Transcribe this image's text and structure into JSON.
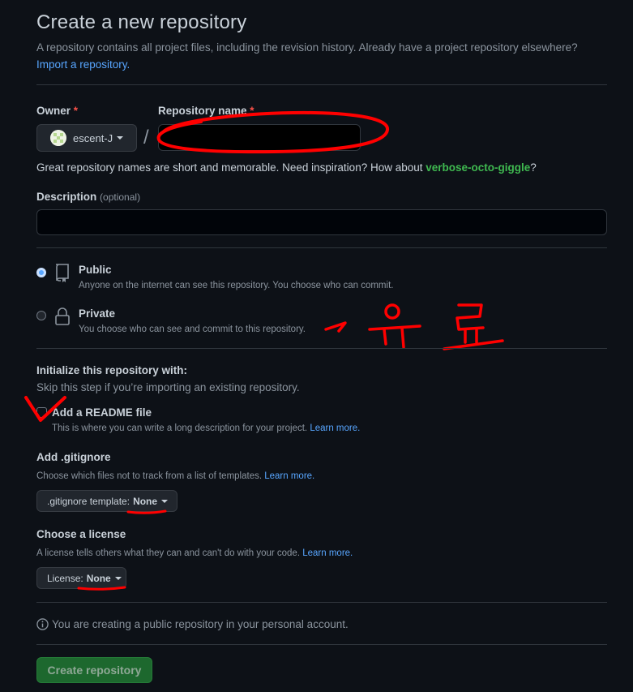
{
  "header": {
    "title": "Create a new repository",
    "description": "A repository contains all project files, including the revision history. Already have a project repository elsewhere?",
    "import_link": "Import a repository."
  },
  "owner": {
    "label": "Owner",
    "required_mark": "*",
    "value": "escent-J"
  },
  "repo_name": {
    "label": "Repository name",
    "required_mark": "*",
    "value": ""
  },
  "separator": "/",
  "suggestion": {
    "text_before": "Great repository names are short and memorable. Need inspiration? How about ",
    "suggested_name": "verbose-octo-giggle",
    "text_after": "?"
  },
  "description_field": {
    "label": "Description",
    "optional": "(optional)",
    "value": ""
  },
  "visibility": {
    "public": {
      "label": "Public",
      "description": "Anyone on the internet can see this repository. You choose who can commit.",
      "selected": true
    },
    "private": {
      "label": "Private",
      "description": "You choose who can see and commit to this repository.",
      "selected": false
    }
  },
  "initialize": {
    "title": "Initialize this repository with:",
    "subtitle": "Skip this step if you’re importing an existing repository.",
    "readme_label": "Add a README file",
    "readme_description": "This is where you can write a long description for your project.",
    "learn_more": "Learn more."
  },
  "gitignore": {
    "title": "Add .gitignore",
    "description": "Choose which files not to track from a list of templates.",
    "learn_more": "Learn more.",
    "button_prefix": ".gitignore template:",
    "button_value": "None"
  },
  "license": {
    "title": "Choose a license",
    "description": "A license tells others what they can and can't do with your code.",
    "learn_more": "Learn more.",
    "button_prefix": "License:",
    "button_value": "None"
  },
  "notice": "You are creating a public repository in your personal account.",
  "submit": "Create repository",
  "annotation_text": "→ 유료",
  "colors": {
    "background": "#0d1117",
    "link": "#58a6ff",
    "suggestion": "#3fb950",
    "primary_button": "#238636",
    "annotation": "#ff0000"
  }
}
